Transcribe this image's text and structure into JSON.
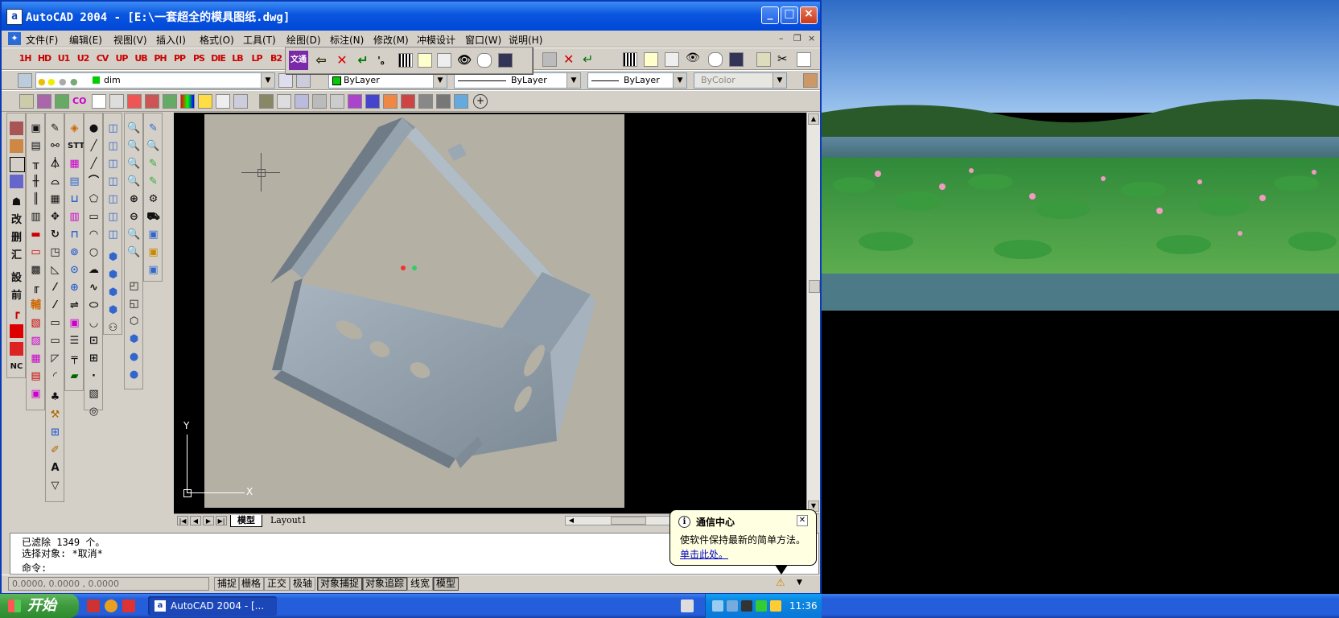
{
  "window": {
    "title": "AutoCAD 2004 - [E:\\一套超全的模具图纸.dwg]",
    "app_icon": "a",
    "minimize": "_",
    "maximize": "□",
    "close": "×"
  },
  "menu": {
    "items": [
      "文件(F)",
      "编辑(E)",
      "视图(V)",
      "插入(I)",
      "格式(O)",
      "工具(T)",
      "绘图(D)",
      "标注(N)",
      "修改(M)",
      "冲模设计",
      "窗口(W)",
      "说明(H)"
    ],
    "mdi_minimize": "–",
    "mdi_restore": "❐",
    "mdi_close": "×"
  },
  "custom_toolbar": {
    "buttons": [
      "1H",
      "HD",
      "U1",
      "U2",
      "CV",
      "UP",
      "UB",
      "PH",
      "PP",
      "PS",
      "DIE",
      "LB",
      "LP",
      "B2"
    ]
  },
  "layers_bar": {
    "layer_name": "dim",
    "color": "ByLayer",
    "linetype": "ByLayer",
    "lineweight": "ByLayer",
    "plotstyle": "ByColor"
  },
  "float_toolbar": {
    "label": "文通"
  },
  "ucs": {
    "y_label": "Y",
    "x_label": "X"
  },
  "layout_tabs": [
    "模型",
    "Layout1"
  ],
  "command": {
    "line1": "已滤除 1349 个。",
    "line2": "选择对象: *取消*",
    "prompt": "命令:"
  },
  "status": {
    "coords": "0.0000,  0.0000  , 0.0000",
    "toggles": [
      {
        "label": "捕捉",
        "pressed": false
      },
      {
        "label": "栅格",
        "pressed": false
      },
      {
        "label": "正交",
        "pressed": false
      },
      {
        "label": "极轴",
        "pressed": false
      },
      {
        "label": "对象捕捉",
        "pressed": true
      },
      {
        "label": "对象追踪",
        "pressed": true
      },
      {
        "label": "线宽",
        "pressed": false
      },
      {
        "label": "模型",
        "pressed": true
      }
    ]
  },
  "balloon": {
    "title": "通信中心",
    "text": "使软件保持最新的简单方法。",
    "link": "单击此处。"
  },
  "taskbar": {
    "start_label": "开始",
    "task_label": "AutoCAD 2004 - [...",
    "clock": "11:36"
  },
  "colors": {
    "titlebar": "#0a55de",
    "chrome": "#d4d0c8",
    "viewport_bg": "#b4b0a4",
    "part": "#8c9aa6"
  }
}
